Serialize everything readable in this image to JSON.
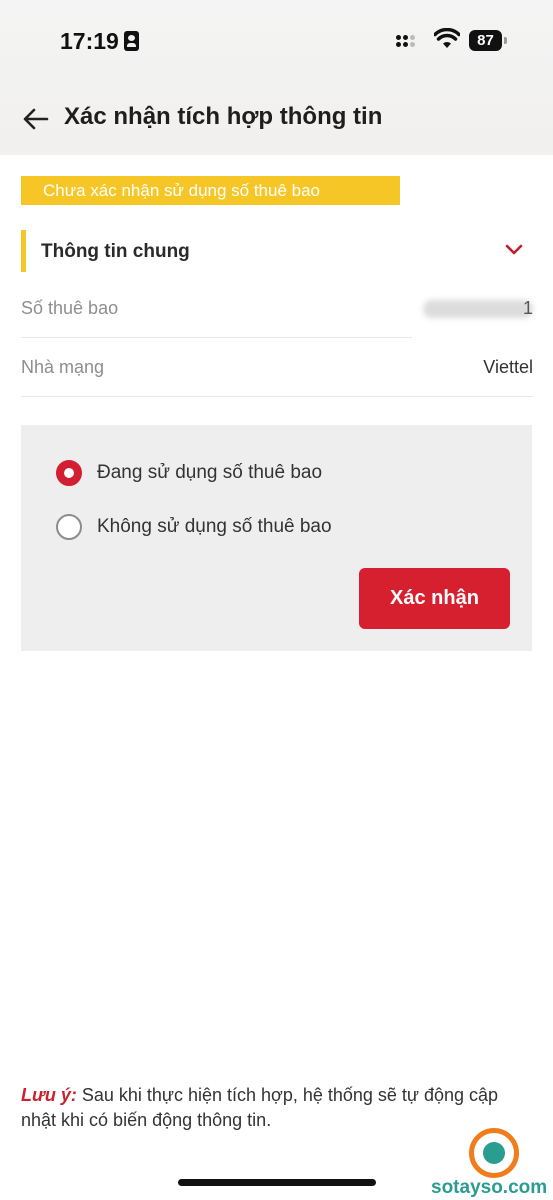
{
  "status_bar": {
    "time": "17:19",
    "battery": "87"
  },
  "header": {
    "title": "Xác nhận tích hợp thông tin"
  },
  "banner": {
    "text": "Chưa xác nhận sử dụng số thuê bao",
    "color": "#f6c626"
  },
  "section": {
    "title": "Thông tin chung",
    "rows": [
      {
        "label": "Số thuê bao",
        "value_visible_tail": "1"
      },
      {
        "label": "Nhà mạng",
        "value": "Viettel"
      }
    ]
  },
  "options": {
    "items": [
      {
        "label": "Đang sử dụng số thuê bao",
        "selected": true
      },
      {
        "label": "Không sử dụng số thuê bao",
        "selected": false
      }
    ],
    "confirm_label": "Xác nhận"
  },
  "note": {
    "label": "Lưu ý:",
    "text": " Sau khi thực hiện tích hợp, hệ thống sẽ tự động cập nhật khi có biến động thông tin."
  },
  "watermark": {
    "text": "sotayso.com"
  },
  "colors": {
    "accent_red": "#d7202f",
    "accent_yellow": "#f6c626"
  }
}
